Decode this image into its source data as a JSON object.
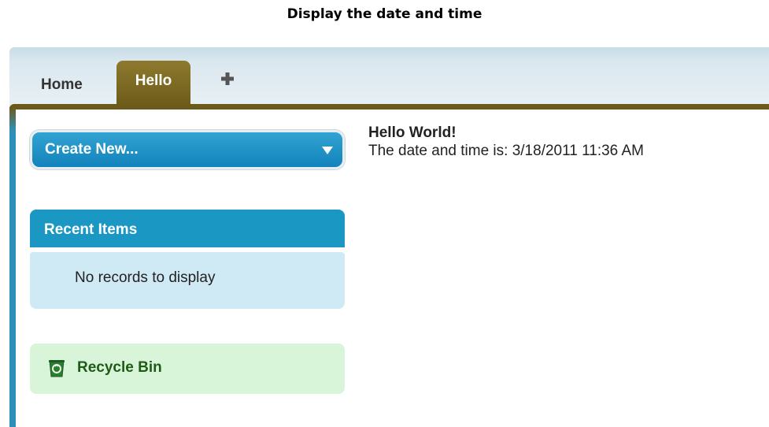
{
  "caption": "Display the date and time",
  "tabs": {
    "home": "Home",
    "hello": "Hello",
    "add": "+"
  },
  "sidebar": {
    "create_new": "Create New...",
    "recent_items": {
      "title": "Recent Items",
      "empty": "No records to display"
    },
    "recycle_bin": "Recycle Bin"
  },
  "main": {
    "heading": "Hello World!",
    "date_line": "The date and time is: 3/18/2011 11:36 AM"
  },
  "colors": {
    "active_tab": "#7a6622",
    "create_button": "#1a8fc2",
    "recent_header": "#1a97c3",
    "recent_body": "#cfe9f5",
    "recycle_bg": "#d9f5d9",
    "recycle_text": "#1f5b16"
  },
  "icons": {
    "dropdown": "chevron-down-icon",
    "add_tab": "plus-icon",
    "recycle": "trash-icon"
  }
}
